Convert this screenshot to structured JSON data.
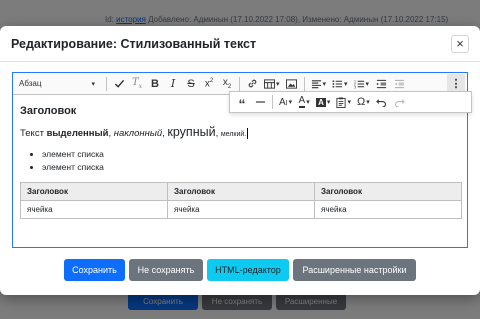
{
  "background": {
    "meta_prefix": "Id:",
    "meta_link": "история",
    "meta_rest": "Добавлено: Админын (17.10.2022 17:08), Изменено: Админын (17.10.2022 17:15)",
    "buttons": [
      "Сохранить",
      "Не сохранять",
      "Расширенные"
    ]
  },
  "modal": {
    "title": "Редактирование: Стилизованный текст",
    "close_label": "×"
  },
  "toolbar": {
    "heading_select": "Абзац",
    "buttons": [
      "check-icon",
      "clear-format-icon",
      "bold-icon",
      "italic-icon",
      "strikethrough-icon",
      "superscript-icon",
      "subscript-icon",
      "link-icon",
      "table-icon",
      "image-icon",
      "align-icon",
      "bulleted-list-icon",
      "numbered-list-icon",
      "indent-icon",
      "outdent-icon",
      "more-icon"
    ],
    "popup": [
      "blockquote-icon",
      "horizontal-line-icon",
      "font-size-icon",
      "font-color-icon",
      "background-color-icon",
      "paste-icon",
      "special-chars-icon",
      "undo-icon",
      "redo-icon"
    ]
  },
  "content": {
    "heading": "Заголовок",
    "paragraph": {
      "prefix": "Текст ",
      "bold": "выделенный",
      "sep1": ", ",
      "italic": "наклонный",
      "sep2": ", ",
      "big": "крупный",
      "sep3": ", ",
      "small": "мелкий."
    },
    "list": [
      "элемент списка",
      "элемент списка"
    ],
    "table": {
      "headers": [
        "Заголовок",
        "Заголовок",
        "Заголовок"
      ],
      "rows": [
        [
          "ячейка",
          "ячейка",
          "ячейка"
        ]
      ]
    }
  },
  "footer": {
    "save": "Сохранить",
    "dont_save": "Не сохранять",
    "html_editor": "HTML-редактор",
    "advanced": "Расширенные настройки"
  },
  "colors": {
    "primary": "#0d6efd",
    "secondary": "#6c757d",
    "info": "#0dcaf0",
    "focus_border": "#2977ff"
  }
}
